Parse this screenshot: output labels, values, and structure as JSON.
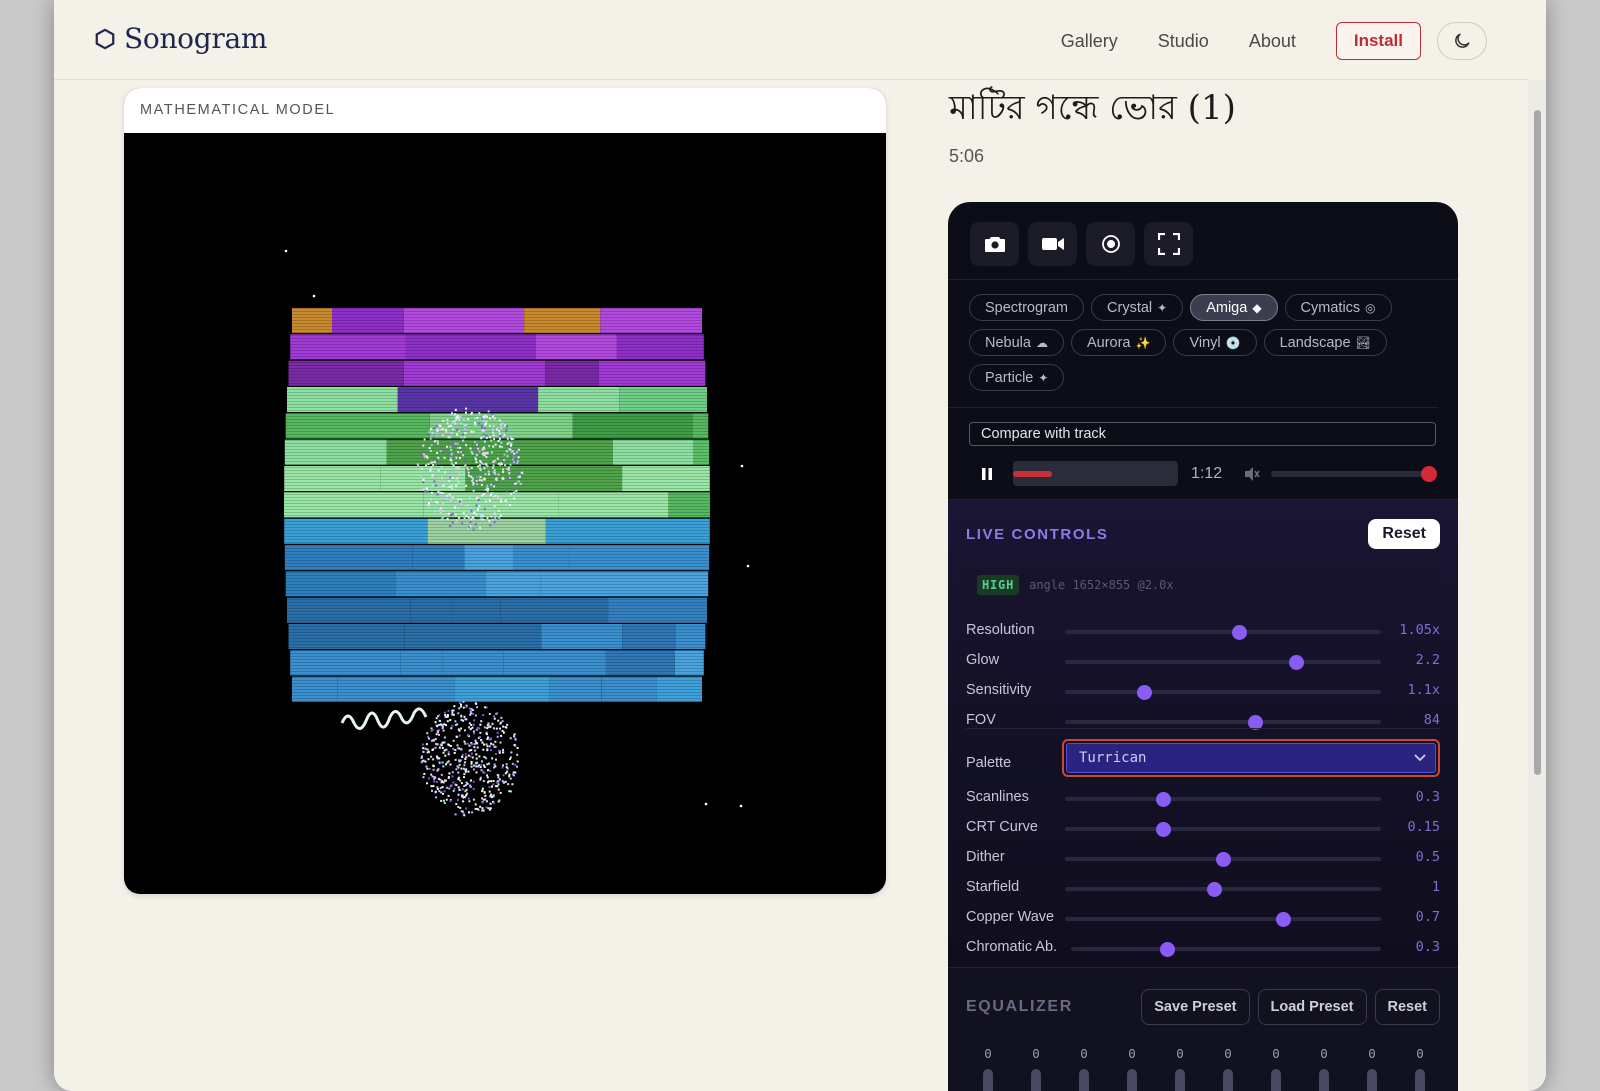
{
  "brand": {
    "name": "Sonogram"
  },
  "nav": {
    "gallery": "Gallery",
    "studio": "Studio",
    "about": "About",
    "install": "Install"
  },
  "visualizer": {
    "caption": "MATHEMATICAL MODEL"
  },
  "track": {
    "title": "মাটির গন্ধে ভোর (1)",
    "duration": "5:06"
  },
  "tools": [
    {
      "name": "camera-icon"
    },
    {
      "name": "video-camera-icon"
    },
    {
      "name": "record-icon"
    },
    {
      "name": "fullscreen-icon"
    }
  ],
  "modes": [
    {
      "label": "Spectrogram",
      "glyph": "",
      "active": false
    },
    {
      "label": "Crystal",
      "glyph": "✦",
      "active": false
    },
    {
      "label": "Amiga",
      "glyph": "◆",
      "active": true
    },
    {
      "label": "Cymatics",
      "glyph": "◎",
      "active": false
    },
    {
      "label": "Nebula",
      "glyph": "☁",
      "active": false
    },
    {
      "label": "Aurora",
      "glyph": "✨",
      "active": false
    },
    {
      "label": "Vinyl",
      "glyph": "💿",
      "active": false
    },
    {
      "label": "Landscape",
      "glyph": "🏞",
      "active": false
    },
    {
      "label": "Particle",
      "glyph": "✦",
      "active": false
    }
  ],
  "player": {
    "compare_label": "Compare with track",
    "time": "1:12",
    "progress": 0.25,
    "volume": 1.0,
    "accent": "#c8303a"
  },
  "live_controls": {
    "title": "LIVE CONTROLS",
    "reset": "Reset",
    "quality_badge": "HIGH",
    "quality_info": "angle 1652×855 @2.0x",
    "sliders_top": [
      {
        "label": "Resolution",
        "value": "1.05x",
        "level": 0.55
      },
      {
        "label": "Glow",
        "value": "2.2",
        "level": 0.73
      },
      {
        "label": "Sensitivity",
        "value": "1.1x",
        "level": 0.25
      },
      {
        "label": "FOV",
        "value": "84",
        "level": 0.6
      }
    ],
    "palette_label": "Palette",
    "palette_value": "Turrican",
    "sliders_bottom": [
      {
        "label": "Scanlines",
        "value": "0.3",
        "level": 0.31
      },
      {
        "label": "CRT Curve",
        "value": "0.15",
        "level": 0.31
      },
      {
        "label": "Dither",
        "value": "0.5",
        "level": 0.5
      },
      {
        "label": "Starfield",
        "value": "1",
        "level": 0.47
      },
      {
        "label": "Copper Wave",
        "value": "0.7",
        "level": 0.69
      },
      {
        "label": "Chromatic Ab.",
        "value": "0.3",
        "level": 0.31
      }
    ]
  },
  "equalizer": {
    "title": "EQUALIZER",
    "save_preset": "Save Preset",
    "load_preset": "Load Preset",
    "reset": "Reset",
    "bands": [
      "0",
      "0",
      "0",
      "0",
      "0",
      "0",
      "0",
      "0",
      "0",
      "0"
    ]
  },
  "colors": {
    "accent": "#8a5cf6",
    "brand": "#1e2650",
    "install": "#b82f35"
  }
}
